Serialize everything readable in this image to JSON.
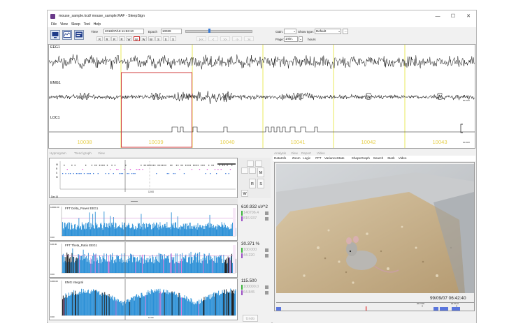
{
  "window": {
    "title": "mouse_sample.kcd/ mouse_sample.RAF - SleepSign",
    "controls": {
      "minimize": "—",
      "maximize": "☐",
      "close": "✕"
    }
  },
  "menu": [
    "File",
    "View",
    "Sleep",
    "Tool",
    "Help"
  ],
  "toolbar": {
    "time_label": "Time",
    "time_value": "2018/07/18 11:53:10",
    "epoch_label": "Epoch",
    "epoch_value": "10039",
    "stage_buttons_row1": [
      "R",
      "R",
      "R",
      "R",
      "W",
      "W",
      "W",
      "W",
      "S",
      "S",
      "S"
    ],
    "selected_stage_index": 5,
    "nav_buttons": [
      "|<<",
      "<",
      ">>",
      "->",
      ">|"
    ],
    "gain_label": "Gain:",
    "show_type_label": "Show type:",
    "show_type_value": "Default",
    "page_label": "Page:",
    "page_value": "1min.",
    "hours_label": "hours"
  },
  "main_chart": {
    "channels": [
      "EEG1",
      "EMG1",
      "LOC1"
    ],
    "epochs": [
      "10038",
      "10039",
      "10040",
      "10041",
      "10042",
      "10043"
    ],
    "stages": [
      "W",
      "W",
      "W",
      "W",
      "S",
      "S"
    ],
    "scale_emg": "50.0UV",
    "scale_loc": "10.0UV"
  },
  "left_tabs": [
    "Hypnogram",
    "Trend graph",
    "View"
  ],
  "hypnogram": {
    "row_labels": [
      "W",
      "R",
      "S",
      "M"
    ],
    "time_label": "12:00",
    "day_label": "Day 16",
    "buttons": [
      "M",
      "R",
      "S",
      "W"
    ]
  },
  "trend": {
    "panels": [
      {
        "title": "FFT  Delta_Power  EEG1",
        "ymax": "10000.00",
        "ymin": "0.00",
        "value": "610.932 uV^2",
        "upper": "140706.4",
        "lower": "816.937"
      },
      {
        "title": "FFT  Theta_Ratio  EEG1",
        "ymax": "100.00",
        "ymin": "0.00",
        "value": "30.371 %",
        "upper": "100.000",
        "lower": "44.220"
      },
      {
        "title": "EMG  Integral",
        "ymax": "1000.00",
        "ymin": "0.00",
        "value": "115.500",
        "upper": "100000.0",
        "lower": "64.845"
      }
    ],
    "time_label": "12:00",
    "undo": "Undo"
  },
  "right_tabs": [
    "Analysis",
    "View",
    "Report",
    "Video"
  ],
  "video_menu": [
    "DataInfo",
    "Zoom",
    "Logic",
    "FFT",
    "VarianceState",
    "ShapeGraph",
    "Search",
    "Mark",
    "Video"
  ],
  "video": {
    "timestamp": "99/09/07  06:42:40",
    "timeline_labels": [
      "02:37:00",
      "02:37:10"
    ],
    "colors": {
      "timeline_block": "#5a76dd",
      "marker": "#e02020"
    }
  },
  "colors": {
    "epoch_line": "#e6e64a",
    "selection_box": "#d23c3c",
    "trend_fill": "#2a8fd6",
    "rem_fill": "#e070d8",
    "upper_bar": "#3cb43c",
    "lower_bar": "#9b4fc4"
  }
}
